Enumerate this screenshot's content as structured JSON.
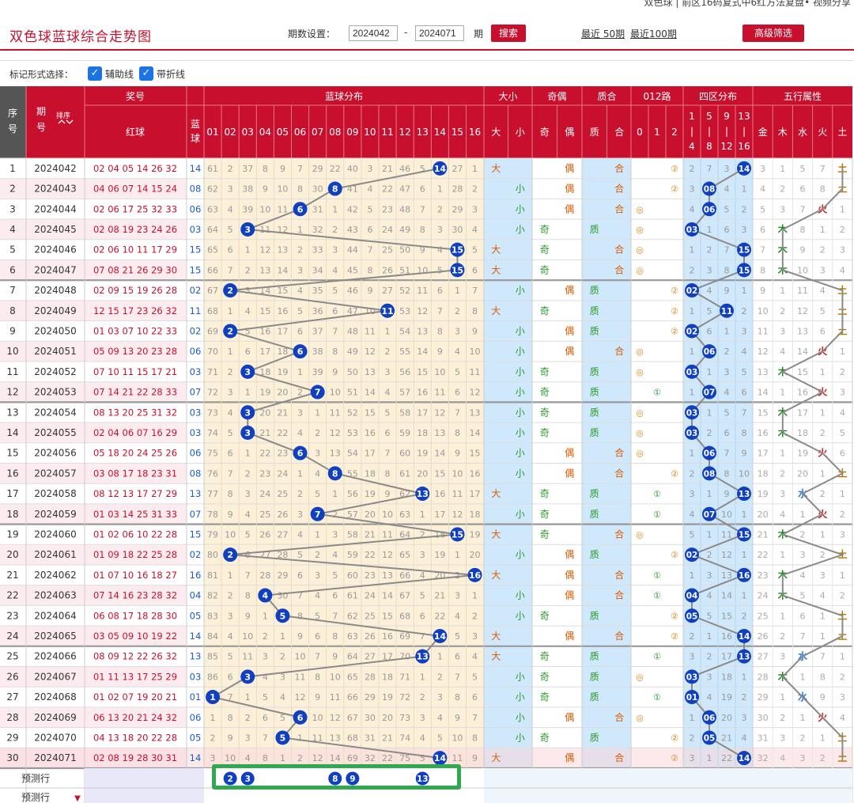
{
  "top_caption": "双色球 | 前区16码复式中6红方法复盘• 视频分享",
  "page_title": "双色球蓝球综合走势图",
  "toolbar": {
    "period_label": "期数设置：",
    "from": "2024042",
    "dash": "-",
    "to": "2024071",
    "unit": "期",
    "search": "搜索",
    "recent50": "最近 50期",
    "recent100": "最近100期",
    "advanced": "高级筛选"
  },
  "options": {
    "label": "标记形式选择：",
    "aux": "辅助线",
    "fold": "带折线",
    "check": "✓"
  },
  "headers": {
    "seq": "序号",
    "period": "期号",
    "sort": "排序",
    "prize": "奖号",
    "red": "红球",
    "blue": "蓝球",
    "blue_dist": "蓝球分布",
    "size": "大小",
    "oddeven": "奇偶",
    "prime": "质合",
    "route": "012路",
    "zone": "四区分布",
    "wuxing": "五行属性",
    "size_cols": [
      "大",
      "小"
    ],
    "oe_cols": [
      "奇",
      "偶"
    ],
    "pc_cols": [
      "质",
      "合"
    ],
    "route_cols": [
      "0",
      "1",
      "2"
    ],
    "zone_cols": [
      [
        "1",
        "|",
        "4"
      ],
      [
        "5",
        "|",
        "8"
      ],
      [
        "9",
        "|",
        "12"
      ],
      [
        "13",
        "|",
        "16"
      ]
    ],
    "wx_cols": [
      "金",
      "木",
      "水",
      "火",
      "土"
    ],
    "nums": [
      "01",
      "02",
      "03",
      "04",
      "05",
      "06",
      "07",
      "08",
      "09",
      "10",
      "11",
      "12",
      "13",
      "14",
      "15",
      "16"
    ]
  },
  "rows": [
    {
      "seq": "1",
      "period": "2024042",
      "red": "02 04 05 14 26 32",
      "blue": "14",
      "miss": [
        61,
        2,
        37,
        8,
        9,
        7,
        29,
        22,
        40,
        3,
        21,
        46,
        5,
        0,
        27,
        1
      ],
      "size": "大",
      "oe": "偶",
      "pc": "合",
      "route": "②",
      "zone": [
        2,
        7,
        3,
        0
      ],
      "wx": [
        3,
        1,
        5,
        7,
        "土"
      ]
    },
    {
      "seq": "2",
      "period": "2024043",
      "red": "04 06 07 14 15 24",
      "blue": "08",
      "miss": [
        62,
        3,
        38,
        9,
        10,
        8,
        30,
        0,
        41,
        4,
        22,
        47,
        6,
        1,
        28,
        2
      ],
      "size": "小",
      "oe": "偶",
      "pc": "合",
      "route": "②",
      "zone": [
        3,
        0,
        4,
        1
      ],
      "wx": [
        4,
        2,
        6,
        8,
        "土"
      ]
    },
    {
      "seq": "3",
      "period": "2024044",
      "red": "02 06 17 25 32 33",
      "blue": "06",
      "miss": [
        63,
        4,
        39,
        10,
        11,
        0,
        31,
        1,
        42,
        5,
        23,
        48,
        7,
        2,
        29,
        3
      ],
      "size": "小",
      "oe": "偶",
      "pc": "合",
      "route": "◎",
      "zone": [
        4,
        0,
        5,
        2
      ],
      "wx": [
        5,
        3,
        7,
        "火",
        1
      ]
    },
    {
      "seq": "4",
      "period": "2024045",
      "red": "02 08 19 23 24 26",
      "blue": "03",
      "miss": [
        64,
        5,
        0,
        11,
        12,
        1,
        32,
        2,
        43,
        6,
        24,
        49,
        8,
        3,
        30,
        4
      ],
      "size": "小",
      "oe": "奇",
      "pc": "质",
      "route": "◎",
      "zone": [
        0,
        1,
        6,
        3
      ],
      "wx": [
        6,
        "木",
        8,
        1,
        2
      ]
    },
    {
      "seq": "5",
      "period": "2024046",
      "red": "02 06 10 11 17 29",
      "blue": "15",
      "miss": [
        65,
        6,
        1,
        12,
        13,
        2,
        33,
        3,
        44,
        7,
        25,
        50,
        9,
        4,
        0,
        5
      ],
      "size": "大",
      "oe": "奇",
      "pc": "合",
      "route": "◎",
      "zone": [
        1,
        2,
        7,
        0
      ],
      "wx": [
        7,
        "木",
        9,
        2,
        3
      ]
    },
    {
      "seq": "6",
      "period": "2024047",
      "red": "07 08 21 26 29 30",
      "blue": "15",
      "miss": [
        66,
        7,
        2,
        13,
        14,
        3,
        34,
        4,
        45,
        8,
        26,
        51,
        10,
        5,
        0,
        6
      ],
      "size": "大",
      "oe": "奇",
      "pc": "合",
      "route": "◎",
      "zone": [
        2,
        3,
        8,
        0
      ],
      "wx": [
        8,
        "木",
        10,
        3,
        4
      ]
    },
    {
      "seq": "7",
      "period": "2024048",
      "red": "02 09 15 19 26 28",
      "blue": "02",
      "miss": [
        67,
        0,
        3,
        14,
        15,
        4,
        35,
        5,
        46,
        9,
        27,
        52,
        11,
        6,
        1,
        7
      ],
      "size": "小",
      "oe": "偶",
      "pc": "质",
      "route": "②",
      "zone": [
        0,
        4,
        9,
        1
      ],
      "wx": [
        9,
        1,
        11,
        4,
        "土"
      ]
    },
    {
      "seq": "8",
      "period": "2024049",
      "red": "12 15 17 23 26 32",
      "blue": "11",
      "miss": [
        68,
        1,
        4,
        15,
        16,
        5,
        36,
        6,
        47,
        10,
        0,
        53,
        12,
        7,
        2,
        8
      ],
      "size": "大",
      "oe": "奇",
      "pc": "质",
      "route": "②",
      "zone": [
        1,
        5,
        0,
        2
      ],
      "wx": [
        10,
        2,
        12,
        5,
        "土"
      ]
    },
    {
      "seq": "9",
      "period": "2024050",
      "red": "01 03 07 10 22 33",
      "blue": "02",
      "miss": [
        69,
        0,
        5,
        16,
        17,
        6,
        37,
        7,
        48,
        11,
        1,
        54,
        13,
        8,
        3,
        9
      ],
      "size": "小",
      "oe": "偶",
      "pc": "质",
      "route": "②",
      "zone": [
        0,
        6,
        1,
        3
      ],
      "wx": [
        11,
        3,
        13,
        6,
        "土"
      ]
    },
    {
      "seq": "10",
      "period": "2024051",
      "red": "05 09 13 20 23 28",
      "blue": "06",
      "miss": [
        70,
        1,
        6,
        17,
        18,
        0,
        38,
        8,
        49,
        12,
        2,
        55,
        14,
        9,
        4,
        10
      ],
      "size": "小",
      "oe": "偶",
      "pc": "合",
      "route": "◎",
      "zone": [
        1,
        0,
        2,
        4
      ],
      "wx": [
        12,
        4,
        14,
        "火",
        1
      ]
    },
    {
      "seq": "11",
      "period": "2024052",
      "red": "07 10 11 15 17 21",
      "blue": "03",
      "miss": [
        71,
        2,
        0,
        18,
        19,
        1,
        39,
        9,
        50,
        13,
        3,
        56,
        15,
        10,
        5,
        11
      ],
      "size": "小",
      "oe": "奇",
      "pc": "质",
      "route": "◎",
      "zone": [
        0,
        1,
        3,
        5
      ],
      "wx": [
        13,
        "木",
        15,
        1,
        2
      ]
    },
    {
      "seq": "12",
      "period": "2024053",
      "red": "07 14 21 22 28 33",
      "blue": "07",
      "miss": [
        72,
        3,
        1,
        19,
        20,
        2,
        0,
        10,
        51,
        14,
        4,
        57,
        16,
        11,
        6,
        12
      ],
      "size": "小",
      "oe": "奇",
      "pc": "质",
      "route": "①",
      "zone": [
        1,
        0,
        4,
        6
      ],
      "wx": [
        14,
        1,
        16,
        "火",
        3
      ]
    },
    {
      "seq": "13",
      "period": "2024054",
      "red": "08 13 20 25 31 32",
      "blue": "03",
      "miss": [
        73,
        4,
        0,
        20,
        21,
        3,
        1,
        11,
        52,
        15,
        5,
        58,
        17,
        12,
        7,
        13
      ],
      "size": "小",
      "oe": "奇",
      "pc": "质",
      "route": "◎",
      "zone": [
        0,
        1,
        5,
        7
      ],
      "wx": [
        15,
        "木",
        17,
        1,
        4
      ]
    },
    {
      "seq": "14",
      "period": "2024055",
      "red": "02 04 06 07 16 29",
      "blue": "03",
      "miss": [
        74,
        5,
        0,
        21,
        22,
        4,
        2,
        12,
        53,
        16,
        6,
        59,
        18,
        13,
        8,
        14
      ],
      "size": "小",
      "oe": "奇",
      "pc": "质",
      "route": "◎",
      "zone": [
        0,
        2,
        6,
        8
      ],
      "wx": [
        16,
        "木",
        18,
        2,
        5
      ]
    },
    {
      "seq": "15",
      "period": "2024056",
      "red": "05 18 20 24 25 26",
      "blue": "06",
      "miss": [
        75,
        6,
        1,
        22,
        23,
        0,
        3,
        13,
        54,
        17,
        7,
        60,
        19,
        14,
        9,
        15
      ],
      "size": "小",
      "oe": "偶",
      "pc": "合",
      "route": "◎",
      "zone": [
        1,
        0,
        7,
        9
      ],
      "wx": [
        17,
        1,
        19,
        "火",
        6
      ]
    },
    {
      "seq": "16",
      "period": "2024057",
      "red": "03 08 17 18 23 31",
      "blue": "08",
      "miss": [
        76,
        7,
        2,
        23,
        24,
        1,
        4,
        0,
        55,
        18,
        8,
        61,
        20,
        15,
        10,
        16
      ],
      "size": "小",
      "oe": "偶",
      "pc": "合",
      "route": "②",
      "zone": [
        2,
        0,
        8,
        10
      ],
      "wx": [
        18,
        2,
        20,
        1,
        "土"
      ]
    },
    {
      "seq": "17",
      "period": "2024058",
      "red": "08 12 13 17 27 29",
      "blue": "13",
      "miss": [
        77,
        8,
        3,
        24,
        25,
        2,
        5,
        1,
        56,
        19,
        9,
        62,
        0,
        16,
        11,
        17
      ],
      "size": "大",
      "oe": "奇",
      "pc": "质",
      "route": "①",
      "zone": [
        3,
        1,
        9,
        0
      ],
      "wx": [
        19,
        3,
        "水",
        2,
        1
      ]
    },
    {
      "seq": "18",
      "period": "2024059",
      "red": "01 03 14 25 31 33",
      "blue": "07",
      "miss": [
        78,
        9,
        4,
        25,
        26,
        3,
        0,
        2,
        57,
        20,
        10,
        63,
        1,
        17,
        12,
        18
      ],
      "size": "小",
      "oe": "奇",
      "pc": "质",
      "route": "①",
      "zone": [
        4,
        0,
        10,
        1
      ],
      "wx": [
        20,
        4,
        1,
        "火",
        2
      ]
    },
    {
      "seq": "19",
      "period": "2024060",
      "red": "01 02 06 10 22 28",
      "blue": "15",
      "miss": [
        79,
        10,
        5,
        26,
        27,
        4,
        1,
        3,
        58,
        21,
        11,
        64,
        2,
        18,
        0,
        19
      ],
      "size": "大",
      "oe": "奇",
      "pc": "合",
      "route": "◎",
      "zone": [
        5,
        1,
        11,
        0
      ],
      "wx": [
        21,
        "木",
        2,
        1,
        3
      ]
    },
    {
      "seq": "20",
      "period": "2024061",
      "red": "01 09 18 22 25 28",
      "blue": "02",
      "miss": [
        80,
        0,
        6,
        27,
        28,
        5,
        2,
        4,
        59,
        22,
        12,
        65,
        3,
        19,
        1,
        20
      ],
      "size": "小",
      "oe": "偶",
      "pc": "质",
      "route": "②",
      "zone": [
        0,
        2,
        12,
        1
      ],
      "wx": [
        22,
        1,
        3,
        2,
        "土"
      ]
    },
    {
      "seq": "21",
      "period": "2024062",
      "red": "01 07 10 16 18 27",
      "blue": "16",
      "miss": [
        81,
        1,
        7,
        28,
        29,
        6,
        3,
        5,
        60,
        23,
        13,
        66,
        4,
        20,
        2,
        0
      ],
      "size": "大",
      "oe": "偶",
      "pc": "合",
      "route": "①",
      "zone": [
        1,
        3,
        13,
        0
      ],
      "wx": [
        23,
        "木",
        4,
        3,
        1
      ]
    },
    {
      "seq": "22",
      "period": "2024063",
      "red": "07 14 16 23 28 32",
      "blue": "04",
      "miss": [
        82,
        2,
        8,
        0,
        30,
        7,
        4,
        6,
        61,
        24,
        14,
        67,
        5,
        21,
        3,
        1
      ],
      "size": "小",
      "oe": "偶",
      "pc": "合",
      "route": "①",
      "zone": [
        0,
        4,
        14,
        1
      ],
      "wx": [
        24,
        "木",
        5,
        4,
        2
      ]
    },
    {
      "seq": "23",
      "period": "2024064",
      "red": "06 08 17 18 28 30",
      "blue": "05",
      "miss": [
        83,
        3,
        9,
        1,
        0,
        8,
        5,
        7,
        62,
        25,
        15,
        68,
        6,
        22,
        4,
        2
      ],
      "size": "小",
      "oe": "奇",
      "pc": "质",
      "route": "②",
      "zone": [
        0,
        5,
        15,
        2
      ],
      "wx": [
        25,
        1,
        6,
        1,
        "土"
      ]
    },
    {
      "seq": "24",
      "period": "2024065",
      "red": "03 05 09 10 19 22",
      "blue": "14",
      "miss": [
        84,
        4,
        10,
        2,
        1,
        9,
        6,
        8,
        63,
        26,
        16,
        69,
        7,
        0,
        5,
        3
      ],
      "size": "大",
      "oe": "偶",
      "pc": "合",
      "route": "②",
      "zone": [
        2,
        1,
        16,
        0
      ],
      "wx": [
        26,
        2,
        7,
        1,
        "土"
      ]
    },
    {
      "seq": "25",
      "period": "2024066",
      "red": "08 09 12 22 26 32",
      "blue": "13",
      "miss": [
        85,
        5,
        11,
        3,
        2,
        10,
        7,
        9,
        64,
        27,
        17,
        70,
        0,
        1,
        6,
        4
      ],
      "size": "大",
      "oe": "奇",
      "pc": "质",
      "route": "①",
      "zone": [
        3,
        2,
        17,
        0
      ],
      "wx": [
        27,
        3,
        "水",
        7,
        1
      ]
    },
    {
      "seq": "26",
      "period": "2024067",
      "red": "01 11 13 17 25 29",
      "blue": "03",
      "miss": [
        86,
        6,
        0,
        4,
        3,
        11,
        8,
        10,
        65,
        28,
        18,
        71,
        1,
        2,
        7,
        5
      ],
      "size": "小",
      "oe": "奇",
      "pc": "质",
      "route": "◎",
      "zone": [
        0,
        3,
        18,
        1
      ],
      "wx": [
        28,
        "木",
        1,
        8,
        2
      ]
    },
    {
      "seq": "27",
      "period": "2024068",
      "red": "01 02 07 19 20 21",
      "blue": "01",
      "miss": [
        0,
        7,
        1,
        5,
        4,
        12,
        9,
        11,
        66,
        29,
        19,
        72,
        2,
        3,
        8,
        6
      ],
      "size": "小",
      "oe": "奇",
      "pc": "质",
      "route": "①",
      "zone": [
        0,
        4,
        19,
        2
      ],
      "wx": [
        29,
        1,
        "水",
        9,
        3
      ]
    },
    {
      "seq": "28",
      "period": "2024069",
      "red": "06 13 20 21 24 32",
      "blue": "06",
      "miss": [
        1,
        8,
        2,
        6,
        5,
        0,
        10,
        12,
        67,
        30,
        20,
        73,
        3,
        4,
        9,
        7
      ],
      "size": "小",
      "oe": "偶",
      "pc": "合",
      "route": "◎",
      "zone": [
        1,
        0,
        20,
        3
      ],
      "wx": [
        30,
        2,
        1,
        "火",
        4
      ]
    },
    {
      "seq": "29",
      "period": "2024070",
      "red": "04 13 18 20 22 28",
      "blue": "05",
      "miss": [
        2,
        9,
        3,
        7,
        0,
        1,
        11,
        13,
        68,
        31,
        21,
        74,
        4,
        5,
        10,
        8
      ],
      "size": "小",
      "oe": "奇",
      "pc": "质",
      "route": "②",
      "zone": [
        2,
        0,
        21,
        4
      ],
      "wx": [
        31,
        3,
        2,
        1,
        "土"
      ]
    },
    {
      "seq": "30",
      "period": "2024071",
      "red": "02 08 19 28 30 31",
      "blue": "14",
      "miss": [
        3,
        10,
        4,
        8,
        1,
        2,
        12,
        14,
        69,
        32,
        22,
        75,
        5,
        0,
        11,
        9
      ],
      "size": "大",
      "oe": "偶",
      "pc": "合",
      "route": "②",
      "zone": [
        3,
        1,
        22,
        0
      ],
      "wx": [
        32,
        4,
        3,
        2,
        "土"
      ]
    }
  ],
  "predict": {
    "label": "预测行",
    "label2": "预测行",
    "arrow": "▼",
    "balls": [
      "2",
      "3",
      "8",
      "9",
      "13"
    ],
    "ball_cols": [
      2,
      3,
      8,
      9,
      13
    ]
  },
  "colors": {
    "header_red": "#c8102e",
    "ball_blue": "#1040c0",
    "accent_green": "#2fa84f"
  }
}
